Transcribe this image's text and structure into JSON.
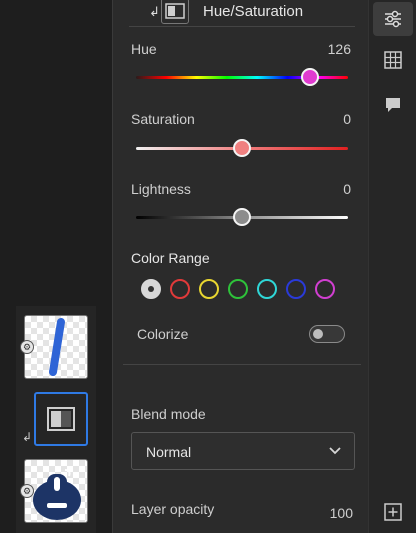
{
  "panel": {
    "title": "Hue/Saturation",
    "hue": {
      "label": "Hue",
      "value": "126",
      "position": 0.82
    },
    "saturation": {
      "label": "Saturation",
      "value": "0",
      "position": 0.5
    },
    "lightness": {
      "label": "Lightness",
      "value": "0",
      "position": 0.5
    },
    "color_range": {
      "label": "Color Range",
      "swatches": [
        {
          "name": "master",
          "color": "#d8d8d8",
          "selected": true
        },
        {
          "name": "reds",
          "color": "#e03a3a"
        },
        {
          "name": "yellows",
          "color": "#e8d630"
        },
        {
          "name": "greens",
          "color": "#2ec23a"
        },
        {
          "name": "cyans",
          "color": "#2fd7d7"
        },
        {
          "name": "blues",
          "color": "#2a3ad8"
        },
        {
          "name": "magentas",
          "color": "#d13fd1"
        }
      ]
    },
    "colorize": {
      "label": "Colorize",
      "enabled": false
    },
    "blend_mode": {
      "label": "Blend mode",
      "value": "Normal"
    },
    "layer_opacity": {
      "label": "Layer opacity",
      "value": "100"
    }
  },
  "colors": {
    "accent": "#2f7ae5",
    "hue_knob": "#e03ad0",
    "sat_knob": "#f08080",
    "light_knob": "#8c8c8c"
  },
  "toolbar": {
    "items": [
      {
        "icon": "adjustments-sliders-icon",
        "active": true
      },
      {
        "icon": "grid-icon",
        "active": false
      },
      {
        "icon": "comment-icon",
        "active": false
      },
      {
        "icon": "add-layer-icon",
        "active": false
      }
    ]
  }
}
